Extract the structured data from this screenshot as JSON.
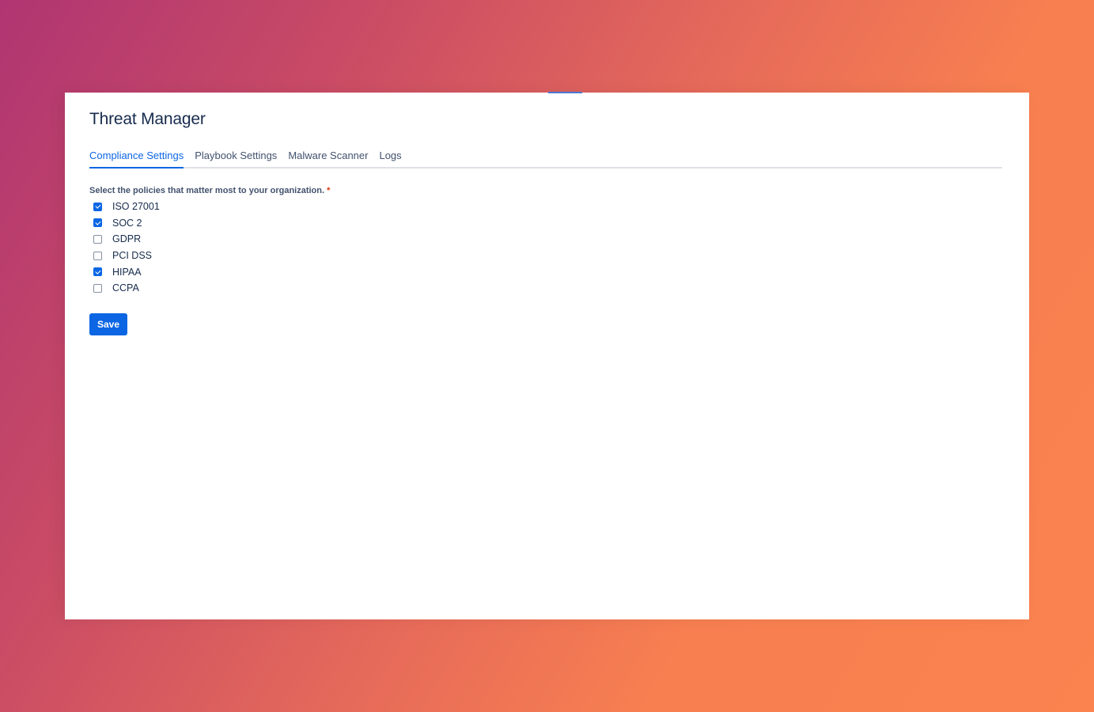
{
  "app": {
    "title": "Threat Manager"
  },
  "tabs": [
    {
      "label": "Compliance Settings",
      "active": true
    },
    {
      "label": "Playbook Settings",
      "active": false
    },
    {
      "label": "Malware Scanner",
      "active": false
    },
    {
      "label": "Logs",
      "active": false
    }
  ],
  "form": {
    "label": "Select the policies that matter most to your organization.",
    "required_marker": "*",
    "options": [
      {
        "label": "ISO 27001",
        "checked": true
      },
      {
        "label": "SOC 2",
        "checked": true
      },
      {
        "label": "GDPR",
        "checked": false
      },
      {
        "label": "PCI DSS",
        "checked": false
      },
      {
        "label": "HIPAA",
        "checked": true
      },
      {
        "label": "CCPA",
        "checked": false
      }
    ],
    "save_label": "Save"
  },
  "colors": {
    "accent": "#0c66e4",
    "heading": "#172b4d",
    "required": "#de350b"
  }
}
